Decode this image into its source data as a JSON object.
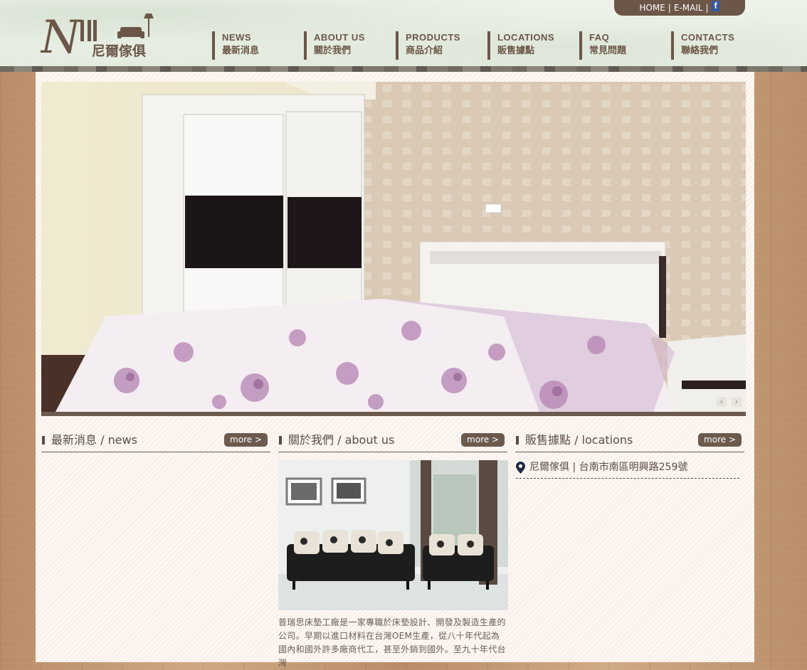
{
  "top_links": {
    "home": "HOME",
    "sep1": "|",
    "email": "E-MAIL",
    "sep2": "|",
    "facebook_glyph": "f"
  },
  "logo": {
    "mark": "Nill",
    "chinese": "尼爾傢俱"
  },
  "nav": [
    {
      "en": "NEWS",
      "zh": "最新消息"
    },
    {
      "en": "ABOUT US",
      "zh": "關於我們"
    },
    {
      "en": "PRODUCTS",
      "zh": "商品介紹"
    },
    {
      "en": "LOCATIONS",
      "zh": "販售據點"
    },
    {
      "en": "FAQ",
      "zh": "常見問題"
    },
    {
      "en": "CONTACTS",
      "zh": "聯絡我們"
    }
  ],
  "slider": {
    "prev": "‹",
    "next": "›"
  },
  "sections": {
    "news": {
      "title": "最新消息 / news",
      "more": "more >"
    },
    "about": {
      "title": "關於我們 / about us",
      "more": "more >",
      "text": "普瑞思床墊工廠是一家專職於床墊設計、開發及製造生產的公司。早期以進口材料在台灣OEM生產，從八十年代起為國內和國外許多廠商代工，甚至外銷到國外。至九十年代台灣"
    },
    "locations": {
      "title": "販售據點 / locations",
      "more": "more >",
      "items": [
        {
          "name": "尼爾傢俱",
          "sep": "|",
          "address": "台南市南區明興路259號"
        }
      ]
    }
  },
  "colors": {
    "brand_brown": "#6b5647",
    "accent_dark": "#5a4c42",
    "facebook": "#3b5998"
  }
}
